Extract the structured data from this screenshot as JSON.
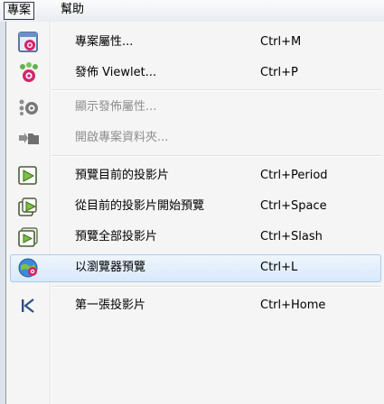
{
  "menubar": {
    "project_label": "專案",
    "help_label": "幫助"
  },
  "menu": {
    "items": [
      {
        "label": "專案屬性...",
        "shortcut": "Ctrl+M",
        "icon": "project-properties-icon"
      },
      {
        "label": "發佈 Viewlet...",
        "shortcut": "Ctrl+P",
        "icon": "publish-viewlet-icon"
      },
      {
        "label": "顯示發佈屬性...",
        "shortcut": "",
        "icon": "publish-settings-icon"
      },
      {
        "label": "開啟專案資料夾...",
        "shortcut": "",
        "icon": "open-folder-icon"
      },
      {
        "label": "預覽目前的投影片",
        "shortcut": "Ctrl+Period",
        "icon": "preview-slide-icon"
      },
      {
        "label": "從目前的投影片開始預覽",
        "shortcut": "Ctrl+Space",
        "icon": "preview-from-slide-icon"
      },
      {
        "label": "預覽全部投影片",
        "shortcut": "Ctrl+Slash",
        "icon": "preview-all-icon"
      },
      {
        "label": "以瀏覽器預覽",
        "shortcut": "Ctrl+L",
        "icon": "browser-preview-icon"
      },
      {
        "label": "第一張投影片",
        "shortcut": "Ctrl+Home",
        "icon": "first-slide-icon"
      }
    ]
  }
}
